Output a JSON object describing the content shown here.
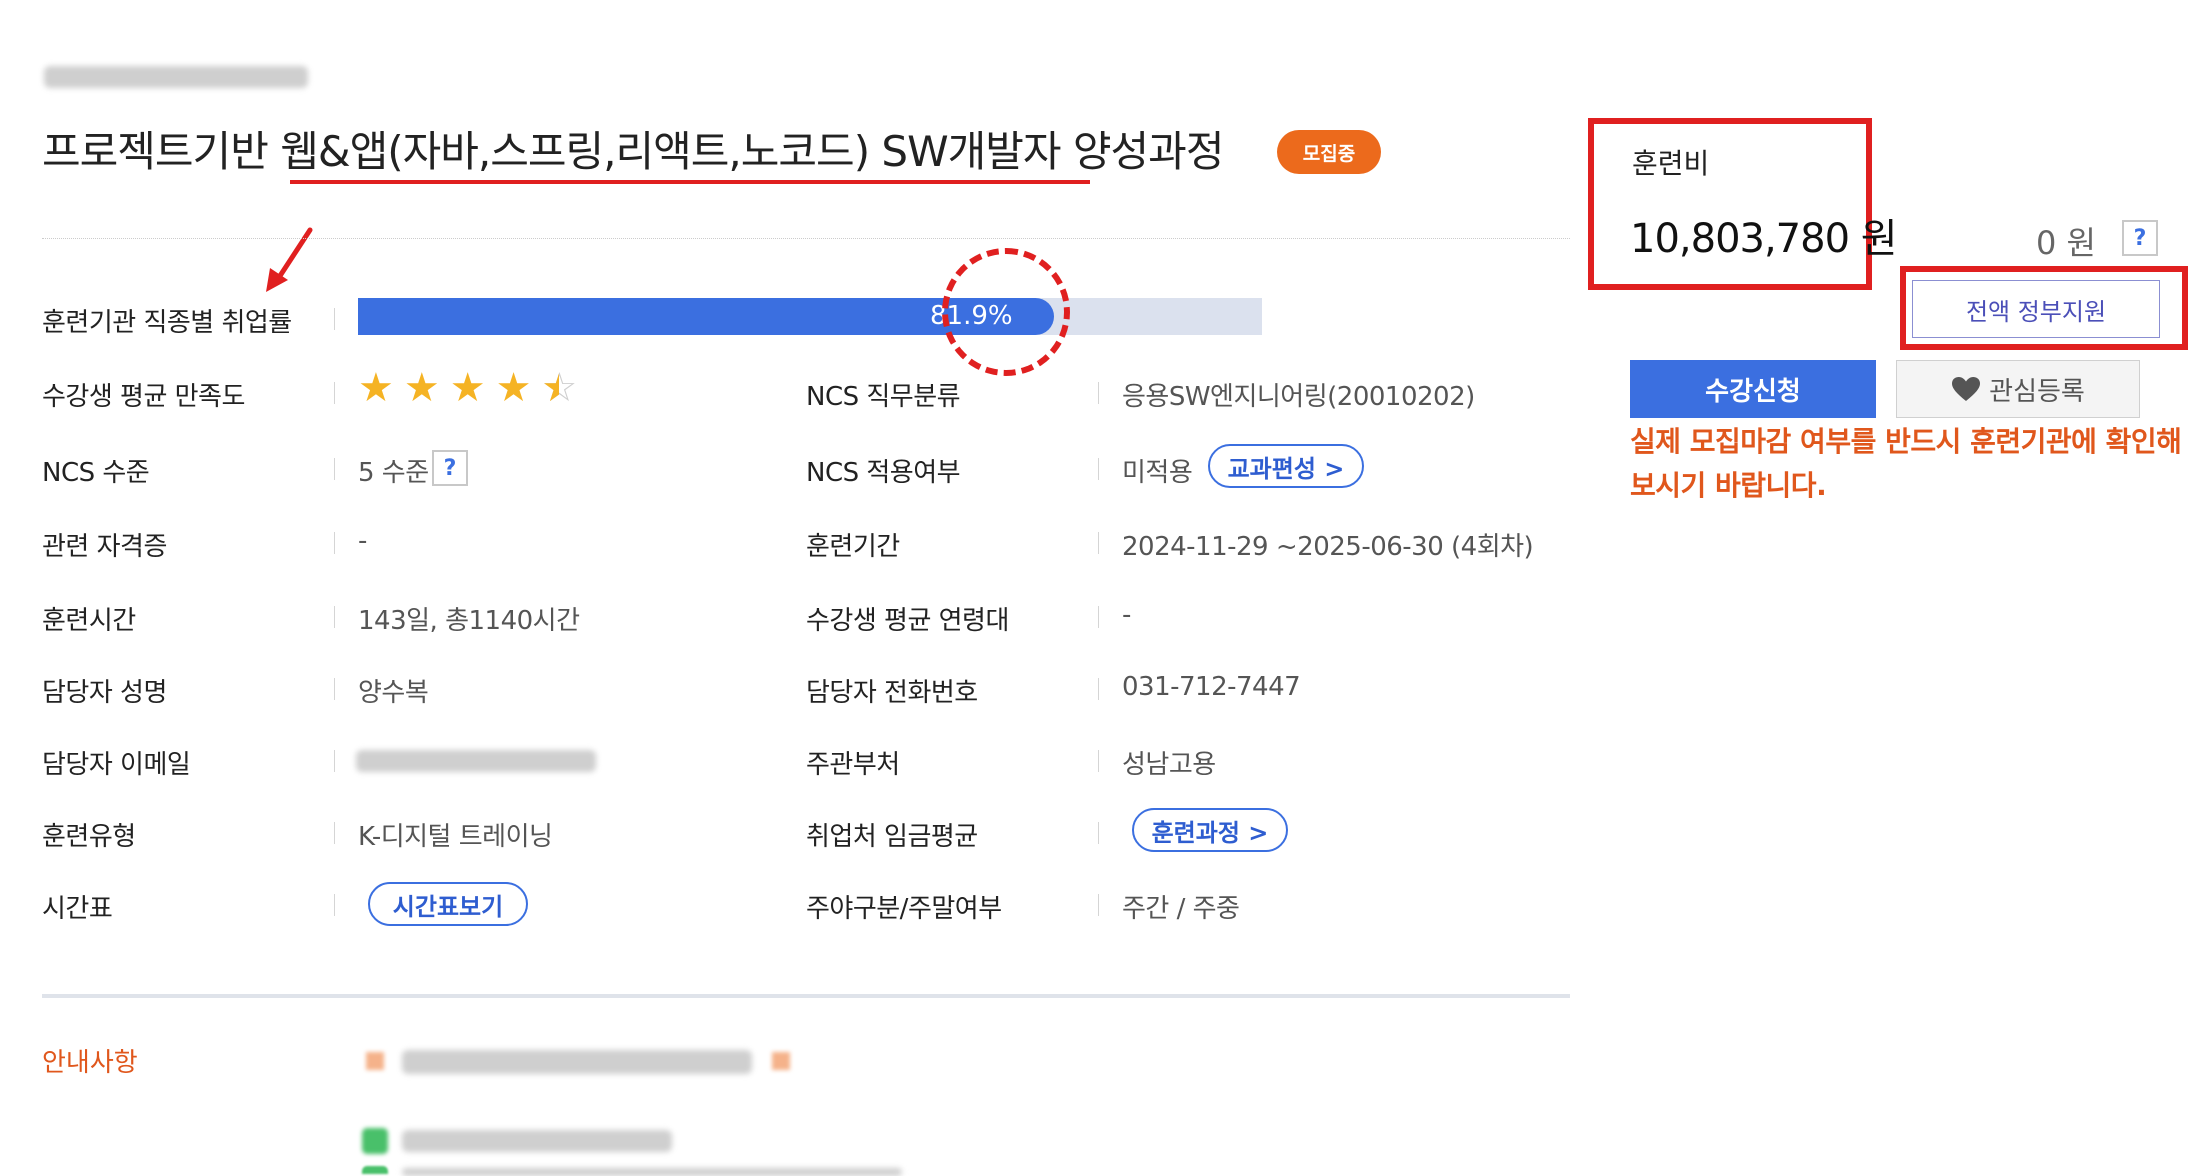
{
  "course": {
    "title": "프로젝트기반 웹&앱(자바,스프링,리액트,노코드) SW개발자 양성과정",
    "status_badge": "모집중"
  },
  "employment": {
    "label": "훈련기관 직종별 취업률",
    "rate_text": "81.9%",
    "rate_value": 81.9
  },
  "rows_left": [
    {
      "label": "수강생 평균 만족도",
      "rating": 4.5,
      "rating_max": 5
    },
    {
      "label": "NCS 수준",
      "value": "5 수준",
      "help": "?"
    },
    {
      "label": "관련 자격증",
      "value": "-"
    },
    {
      "label": "훈련시간",
      "value": "143일, 총1140시간"
    },
    {
      "label": "담당자 성명",
      "value": "양수복"
    },
    {
      "label": "담당자 이메일",
      "value": ""
    },
    {
      "label": "훈련유형",
      "value": "K-디지털 트레이닝"
    },
    {
      "label": "시간표",
      "button": "시간표보기"
    }
  ],
  "rows_right": [
    {
      "label": "NCS 직무분류",
      "value": "응용SW엔지니어링(20010202)"
    },
    {
      "label": "NCS 적용여부",
      "value": "미적용",
      "button": "교과편성 >"
    },
    {
      "label": "훈련기간",
      "value": "2024-11-29 ~2025-06-30 (4회차)"
    },
    {
      "label": "수강생 평균 연령대",
      "value": "-"
    },
    {
      "label": "담당자 전화번호",
      "value": "031-712-7447"
    },
    {
      "label": "주관부처",
      "value": "성남고용"
    },
    {
      "label": "취업처 임금평균",
      "button": "훈련과정 >"
    },
    {
      "label": "주야구분/주말여부",
      "value": "주간 / 주중"
    }
  ],
  "notice": {
    "label": "안내사항"
  },
  "price": {
    "label": "훈련비",
    "value": "10,803,780 원",
    "self_pay": "0 원",
    "help": "?",
    "gov_support": "전액 정부지원"
  },
  "actions": {
    "apply": "수강신청",
    "favorite": "관심등록"
  },
  "warning": "실제 모집마감 여부를 반드시 훈련기관에 확인해보시기 바랍니다.",
  "colors": {
    "accent_blue": "#3b6fe0",
    "badge_orange": "#ec6a1c",
    "annotation_red": "#e02020",
    "warning_orange": "#e0571c"
  }
}
